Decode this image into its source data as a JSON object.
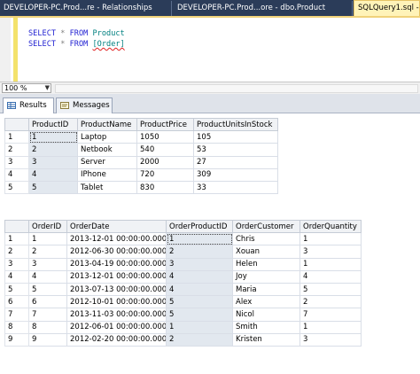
{
  "document_tabs": [
    {
      "label": "DEVELOPER-PC.Prod...re - Relationships"
    },
    {
      "label": "DEVELOPER-PC.Prod...ore - dbo.Product"
    },
    {
      "label": "SQLQuery1.sql -"
    }
  ],
  "editor": {
    "line1": {
      "kw1": "SELECT",
      "star": "*",
      "kw2": "FROM",
      "table": "Product"
    },
    "line2": {
      "kw1": "SELECT",
      "star": "*",
      "kw2": "FROM",
      "table": "[Order]"
    }
  },
  "zoom": {
    "value": "100 %"
  },
  "result_tabs": [
    {
      "label": "Results",
      "icon": "grid-icon"
    },
    {
      "label": "Messages",
      "icon": "messages-icon"
    }
  ],
  "grid1": {
    "columns": [
      "ProductID",
      "ProductName",
      "ProductPrice",
      "ProductUnitsInStock"
    ],
    "rows": [
      {
        "rn": "1",
        "cells": [
          "1",
          "Laptop",
          "1050",
          "105"
        ]
      },
      {
        "rn": "2",
        "cells": [
          "2",
          "Netbook",
          "540",
          "53"
        ]
      },
      {
        "rn": "3",
        "cells": [
          "3",
          "Server",
          "2000",
          "27"
        ]
      },
      {
        "rn": "4",
        "cells": [
          "4",
          "IPhone",
          "720",
          "309"
        ]
      },
      {
        "rn": "5",
        "cells": [
          "5",
          "Tablet",
          "830",
          "33"
        ]
      }
    ]
  },
  "grid2": {
    "columns": [
      "OrderID",
      "OrderDate",
      "OrderProductID",
      "OrderCustomer",
      "OrderQuantity"
    ],
    "rows": [
      {
        "rn": "1",
        "cells": [
          "1",
          "2013-12-01 00:00:00.000",
          "1",
          "Chris",
          "1"
        ]
      },
      {
        "rn": "2",
        "cells": [
          "2",
          "2012-06-30 00:00:00.000",
          "2",
          "Xouan",
          "3"
        ]
      },
      {
        "rn": "3",
        "cells": [
          "3",
          "2013-04-19 00:00:00.000",
          "3",
          "Helen",
          "1"
        ]
      },
      {
        "rn": "4",
        "cells": [
          "4",
          "2013-12-01 00:00:00.000",
          "4",
          "Joy",
          "4"
        ]
      },
      {
        "rn": "5",
        "cells": [
          "5",
          "2013-07-13 00:00:00.000",
          "4",
          "Maria",
          "5"
        ]
      },
      {
        "rn": "6",
        "cells": [
          "6",
          "2012-10-01 00:00:00.000",
          "5",
          "Alex",
          "2"
        ]
      },
      {
        "rn": "7",
        "cells": [
          "7",
          "2013-11-03 00:00:00.000",
          "5",
          "Nicol",
          "7"
        ]
      },
      {
        "rn": "8",
        "cells": [
          "8",
          "2012-06-01 00:00:00.000",
          "1",
          "Smith",
          "1"
        ]
      },
      {
        "rn": "9",
        "cells": [
          "9",
          "2012-02-20 00:00:00.000",
          "2",
          "Kristen",
          "3"
        ]
      }
    ]
  }
}
